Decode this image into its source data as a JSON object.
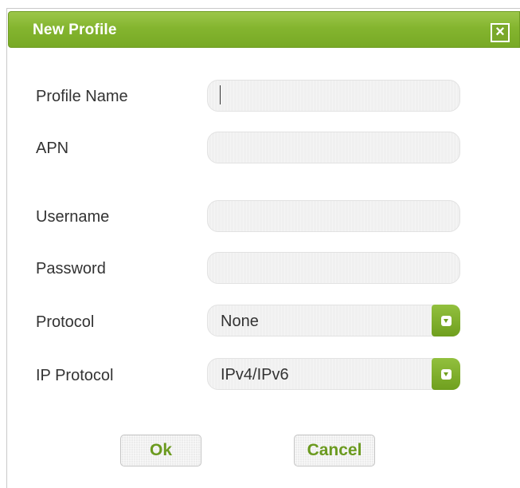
{
  "dialog": {
    "title": "New Profile",
    "close_icon": "close-icon",
    "close_glyph": "×"
  },
  "form": {
    "profile_name": {
      "label": "Profile Name",
      "value": "",
      "focused": true
    },
    "apn": {
      "label": "APN",
      "value": ""
    },
    "username": {
      "label": "Username",
      "value": ""
    },
    "password": {
      "label": "Password",
      "value": ""
    },
    "protocol": {
      "label": "Protocol",
      "selected": "None",
      "arrow_icon": "chevron-down-icon"
    },
    "ip_protocol": {
      "label": "IP Protocol",
      "selected": "IPv4/IPv6",
      "arrow_icon": "chevron-down-icon"
    }
  },
  "buttons": {
    "ok_label": "Ok",
    "cancel_label": "Cancel"
  },
  "colors": {
    "accent": "#84b52f",
    "button_text": "#6b9a1f"
  }
}
